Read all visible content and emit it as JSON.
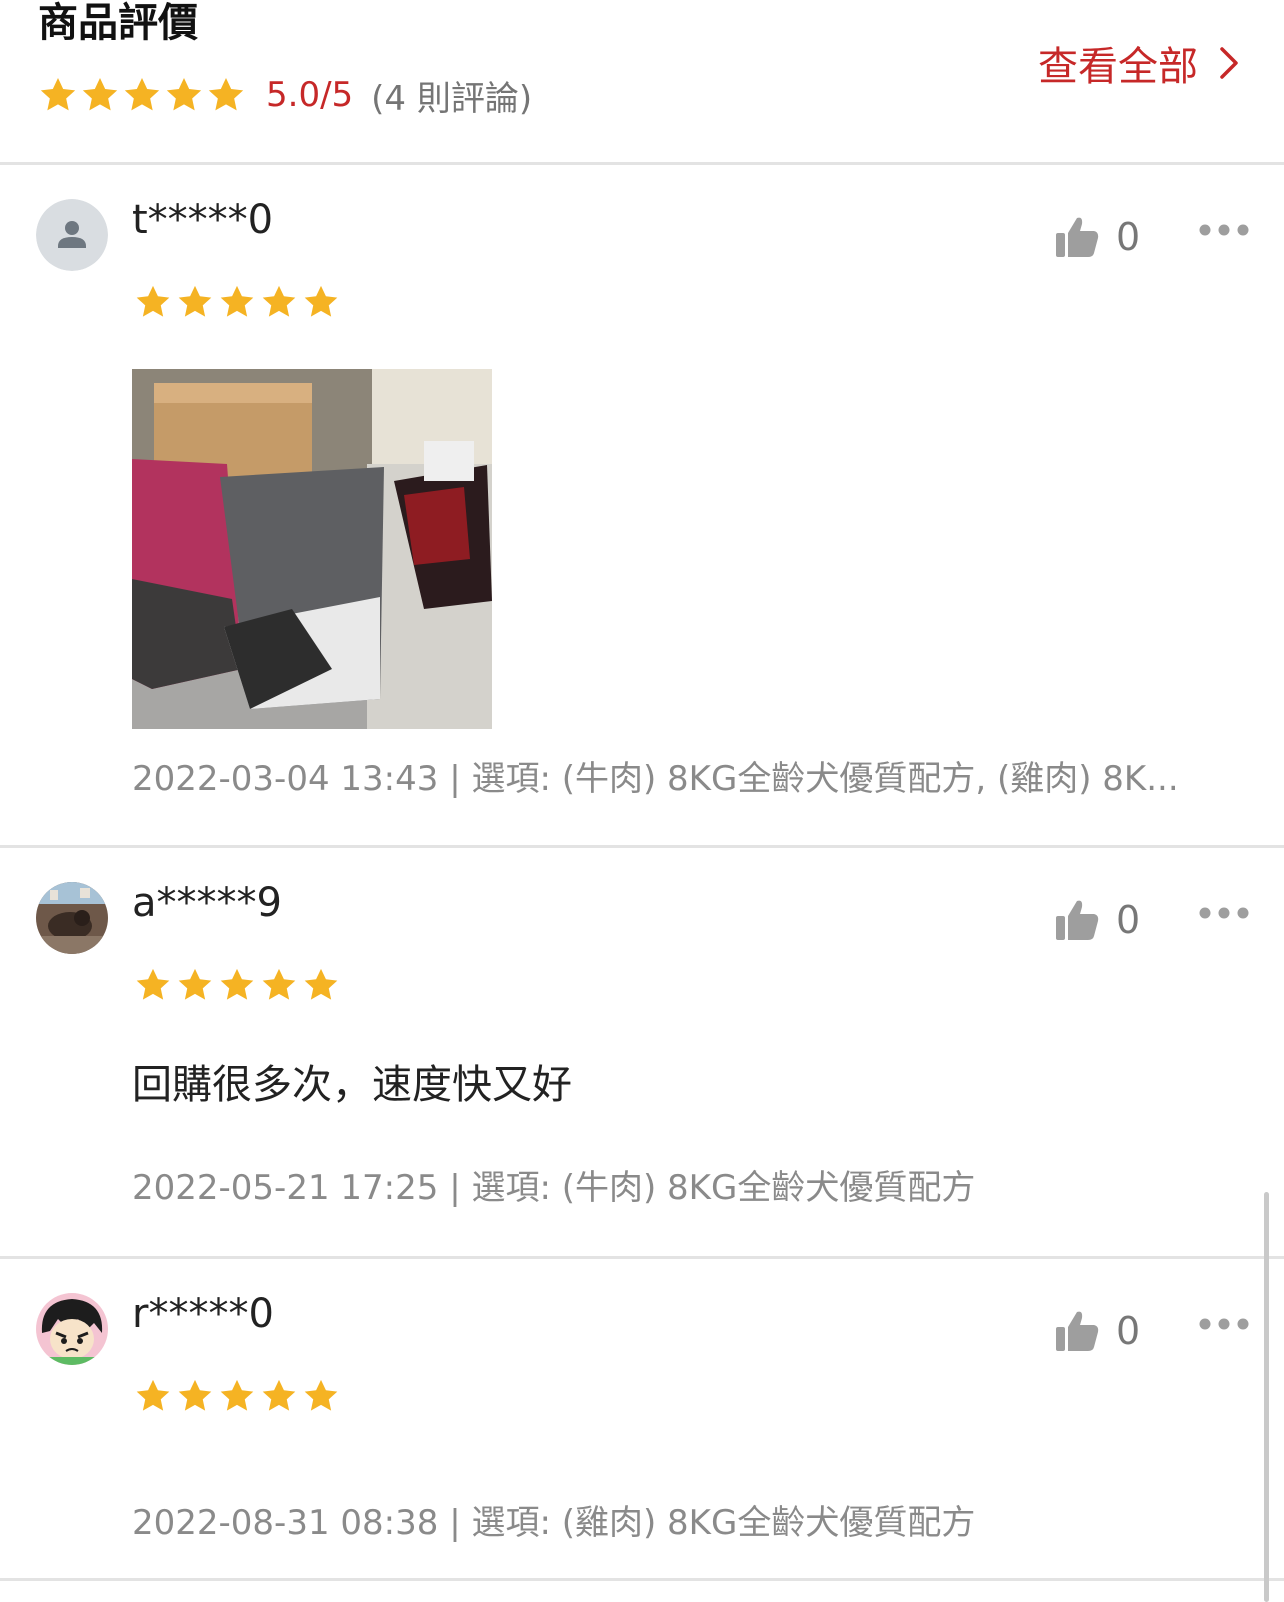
{
  "header": {
    "title": "商品評價",
    "score": "5.0/5",
    "review_count": "(4 則評論)",
    "view_all_label": "查看全部",
    "star_count": 5
  },
  "colors": {
    "accent": "#c62828",
    "star": "#f5b323",
    "muted_text": "#8a8a8a"
  },
  "reviews": [
    {
      "username": "t*****0",
      "rating": 5,
      "likes": "0",
      "text": "",
      "has_photo": true,
      "meta": "2022-03-04 13:43 | 選項: (牛肉) 8KG全齡犬優質配方, (雞肉) 8K..."
    },
    {
      "username": "a*****9",
      "rating": 5,
      "likes": "0",
      "text": "回購很多次，速度快又好",
      "has_photo": false,
      "meta": "2022-05-21 17:25 | 選項: (牛肉) 8KG全齡犬優質配方"
    },
    {
      "username": "r*****0",
      "rating": 5,
      "likes": "0",
      "text": "",
      "has_photo": false,
      "meta": "2022-08-31 08:38 | 選項: (雞肉) 8KG全齡犬優質配方"
    }
  ]
}
